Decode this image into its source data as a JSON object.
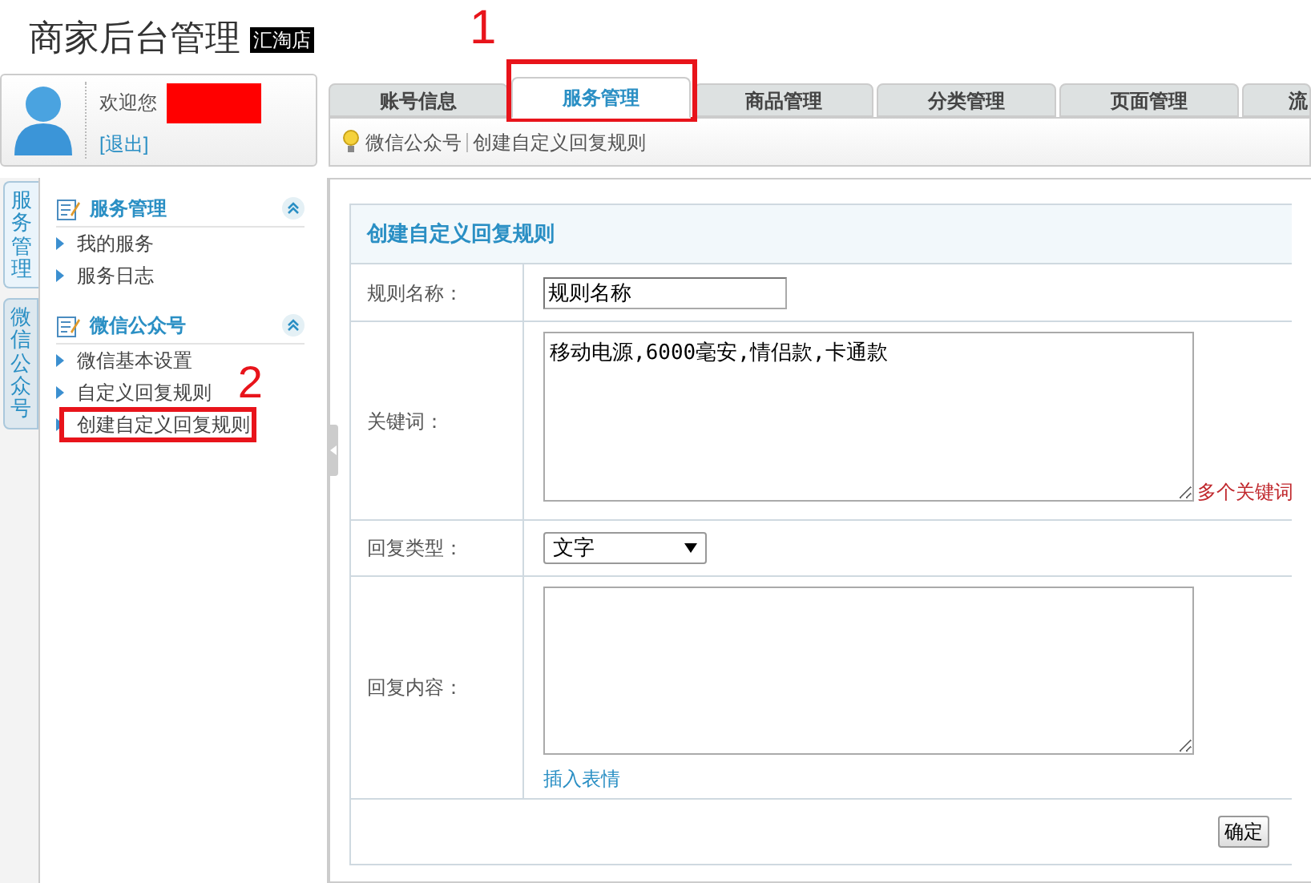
{
  "header": {
    "title": "商家后台管理",
    "shop_badge": "汇淘店"
  },
  "user": {
    "greeting": "欢迎您",
    "name_redacted": true,
    "logout": "[退出]"
  },
  "tabs": [
    {
      "label": "账号信息",
      "selected": false
    },
    {
      "label": "服务管理",
      "selected": true,
      "callout": "1"
    },
    {
      "label": "商品管理",
      "selected": false
    },
    {
      "label": "分类管理",
      "selected": false
    },
    {
      "label": "页面管理",
      "selected": false
    },
    {
      "label": "流",
      "selected": false
    }
  ],
  "breadcrumb": [
    "微信公众号",
    "创建自定义回复规则"
  ],
  "side_tabs": [
    {
      "label": "服务管理",
      "selected": true
    },
    {
      "label": "微信公众号",
      "selected": false
    }
  ],
  "sidebar": {
    "groups": [
      {
        "title": "服务管理",
        "expanded": true,
        "items": [
          {
            "label": "我的服务"
          },
          {
            "label": "服务日志"
          }
        ]
      },
      {
        "title": "微信公众号",
        "expanded": true,
        "items": [
          {
            "label": "微信基本设置"
          },
          {
            "label": "自定义回复规则"
          },
          {
            "label": "创建自定义回复规则",
            "callout": "2"
          }
        ]
      }
    ]
  },
  "form": {
    "title": "创建自定义回复规则",
    "fields": [
      {
        "kind": "text",
        "label": "规则名称：",
        "value": "规则名称"
      },
      {
        "kind": "textarea",
        "label": "关键词：",
        "value": "移动电源,6000毫安,情侣款,卡通款",
        "hint": "多个关键词"
      },
      {
        "kind": "select",
        "label": "回复类型：",
        "value": "文字"
      },
      {
        "kind": "textarea",
        "label": "回复内容：",
        "link": "插入表情"
      }
    ],
    "submit": "确定"
  }
}
